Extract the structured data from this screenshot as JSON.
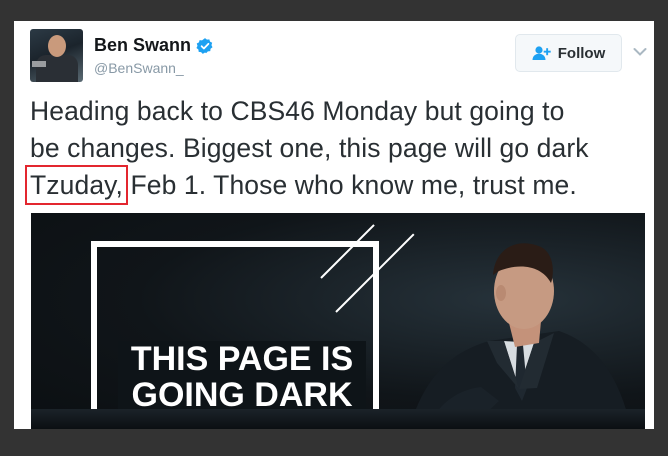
{
  "author": {
    "name": "Ben Swann",
    "handle": "@BenSwann_"
  },
  "follow_label": "Follow",
  "tweet": {
    "line1": "Heading back to CBS46 Monday but going to",
    "line2": "be changes. Biggest one, this page will go dark",
    "highlighted_word": "Tzuday,",
    "line3_rest": " Feb 1.  Those who know me, trust me."
  },
  "media": {
    "headline_line1": "THIS PAGE IS",
    "headline_line2": "GOING DARK"
  },
  "colors": {
    "page_background": "#333333",
    "verified_blue": "#1da1f2",
    "highlight_red": "#e3262f",
    "text": "#292f33",
    "handle": "#8899a6"
  },
  "icons": {
    "verified": "verified-badge-icon",
    "follow": "add-user-icon",
    "more": "chevron-down-icon"
  }
}
